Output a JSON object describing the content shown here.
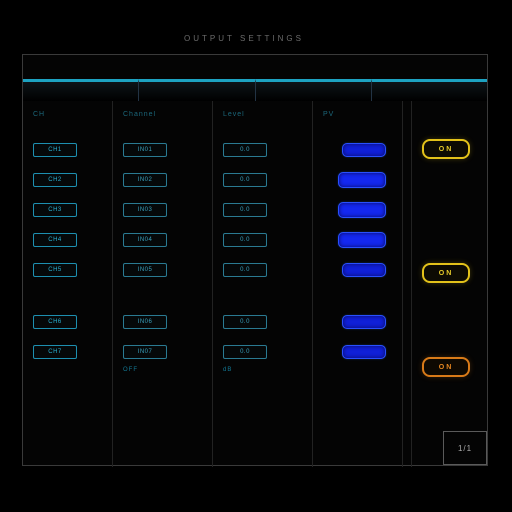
{
  "title": "OUTPUT SETTINGS",
  "colors": {
    "accent": "#1da3c2",
    "pill": "#1428f0",
    "warn": "#e3c21a",
    "alert": "#d87a18"
  },
  "tabs": [
    {
      "label": ""
    },
    {
      "label": ""
    },
    {
      "label": ""
    },
    {
      "label": ""
    }
  ],
  "columns": {
    "headers": [
      "CH",
      "Channel",
      "Level",
      "PV"
    ],
    "rows": [
      {
        "c0": "CH1",
        "c1": "IN01",
        "c2": "0.0",
        "pill": true
      },
      {
        "c0": "CH2",
        "c1": "IN02",
        "c2": "0.0",
        "pill": true,
        "pill_size": "lg"
      },
      {
        "c0": "CH3",
        "c1": "IN03",
        "c2": "0.0",
        "pill": true,
        "pill_size": "lg"
      },
      {
        "c0": "CH4",
        "c1": "IN04",
        "c2": "0.0",
        "pill": true,
        "pill_size": "lg"
      },
      {
        "c0": "CH5",
        "c1": "IN05",
        "c2": "0.0",
        "pill": true
      }
    ],
    "group2": [
      {
        "c0": "CH6",
        "c1": "IN06",
        "c2": "0.0",
        "pill": true
      },
      {
        "c0": "CH7",
        "c1": "IN07",
        "c2": "0.0",
        "pill": true
      }
    ],
    "footers": [
      "",
      "OFF",
      "dB",
      ""
    ]
  },
  "sidebar": {
    "btn1": "ON",
    "btn2": "ON",
    "btn3": "ON"
  },
  "corner": "1/1"
}
